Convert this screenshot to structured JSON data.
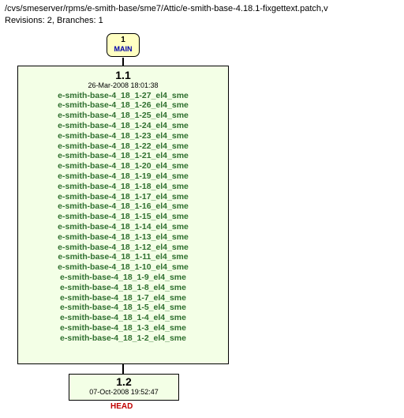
{
  "header": {
    "path": "/cvs/smeserver/rpms/e-smith-base/sme7/Attic/e-smith-base-4.18.1-fixgettext.patch,v",
    "revisions_line": "Revisions: 2, Branches: 1"
  },
  "main_node": {
    "index": "1",
    "label": "MAIN"
  },
  "rev11": {
    "version": "1.1",
    "date": "26-Mar-2008 18:01:38",
    "tags": [
      "e-smith-base-4_18_1-27_el4_sme",
      "e-smith-base-4_18_1-26_el4_sme",
      "e-smith-base-4_18_1-25_el4_sme",
      "e-smith-base-4_18_1-24_el4_sme",
      "e-smith-base-4_18_1-23_el4_sme",
      "e-smith-base-4_18_1-22_el4_sme",
      "e-smith-base-4_18_1-21_el4_sme",
      "e-smith-base-4_18_1-20_el4_sme",
      "e-smith-base-4_18_1-19_el4_sme",
      "e-smith-base-4_18_1-18_el4_sme",
      "e-smith-base-4_18_1-17_el4_sme",
      "e-smith-base-4_18_1-16_el4_sme",
      "e-smith-base-4_18_1-15_el4_sme",
      "e-smith-base-4_18_1-14_el4_sme",
      "e-smith-base-4_18_1-13_el4_sme",
      "e-smith-base-4_18_1-12_el4_sme",
      "e-smith-base-4_18_1-11_el4_sme",
      "e-smith-base-4_18_1-10_el4_sme",
      "e-smith-base-4_18_1-9_el4_sme",
      "e-smith-base-4_18_1-8_el4_sme",
      "e-smith-base-4_18_1-7_el4_sme",
      "e-smith-base-4_18_1-5_el4_sme",
      "e-smith-base-4_18_1-4_el4_sme",
      "e-smith-base-4_18_1-3_el4_sme",
      "e-smith-base-4_18_1-2_el4_sme"
    ]
  },
  "rev12": {
    "version": "1.2",
    "date": "07-Oct-2008 19:52:47",
    "head_label": "HEAD"
  }
}
